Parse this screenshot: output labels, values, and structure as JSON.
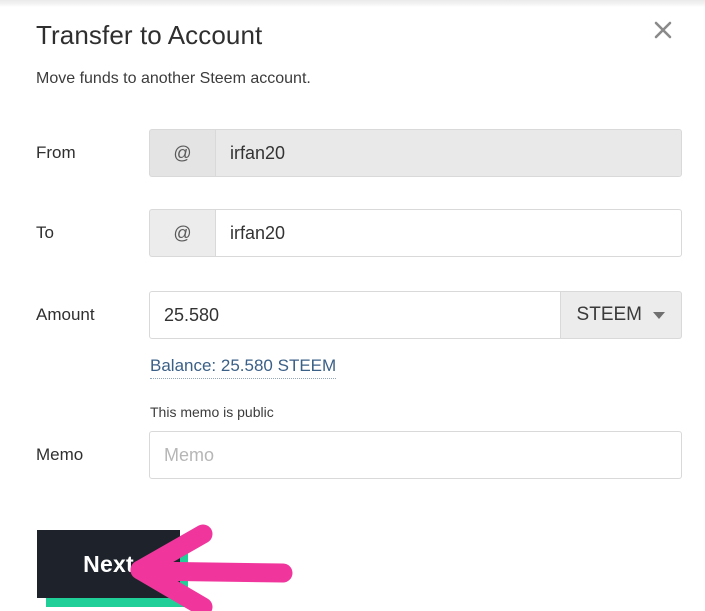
{
  "dialog": {
    "title": "Transfer to Account",
    "subtitle": "Move funds to another Steem account.",
    "close_label": "×"
  },
  "form": {
    "from": {
      "label": "From",
      "addon": "@",
      "value": "irfan20",
      "disabled": true
    },
    "to": {
      "label": "To",
      "addon": "@",
      "value": "irfan20",
      "disabled": false
    },
    "amount": {
      "label": "Amount",
      "value": "25.580",
      "currency": "STEEM",
      "balance_link": "Balance: 25.580 STEEM"
    },
    "memo": {
      "label": "Memo",
      "hint": "This memo is public",
      "placeholder": "Memo",
      "value": ""
    }
  },
  "actions": {
    "next_label": "Next"
  },
  "annotation": {
    "arrow_color": "#f0369c",
    "arrow_direction": "left"
  },
  "colors": {
    "accent_teal": "#1fcf97",
    "button_dark": "#1d222b",
    "link_blue": "#3b6087",
    "addon_grey": "#ececec",
    "disabled_grey": "#e9e9e9"
  }
}
